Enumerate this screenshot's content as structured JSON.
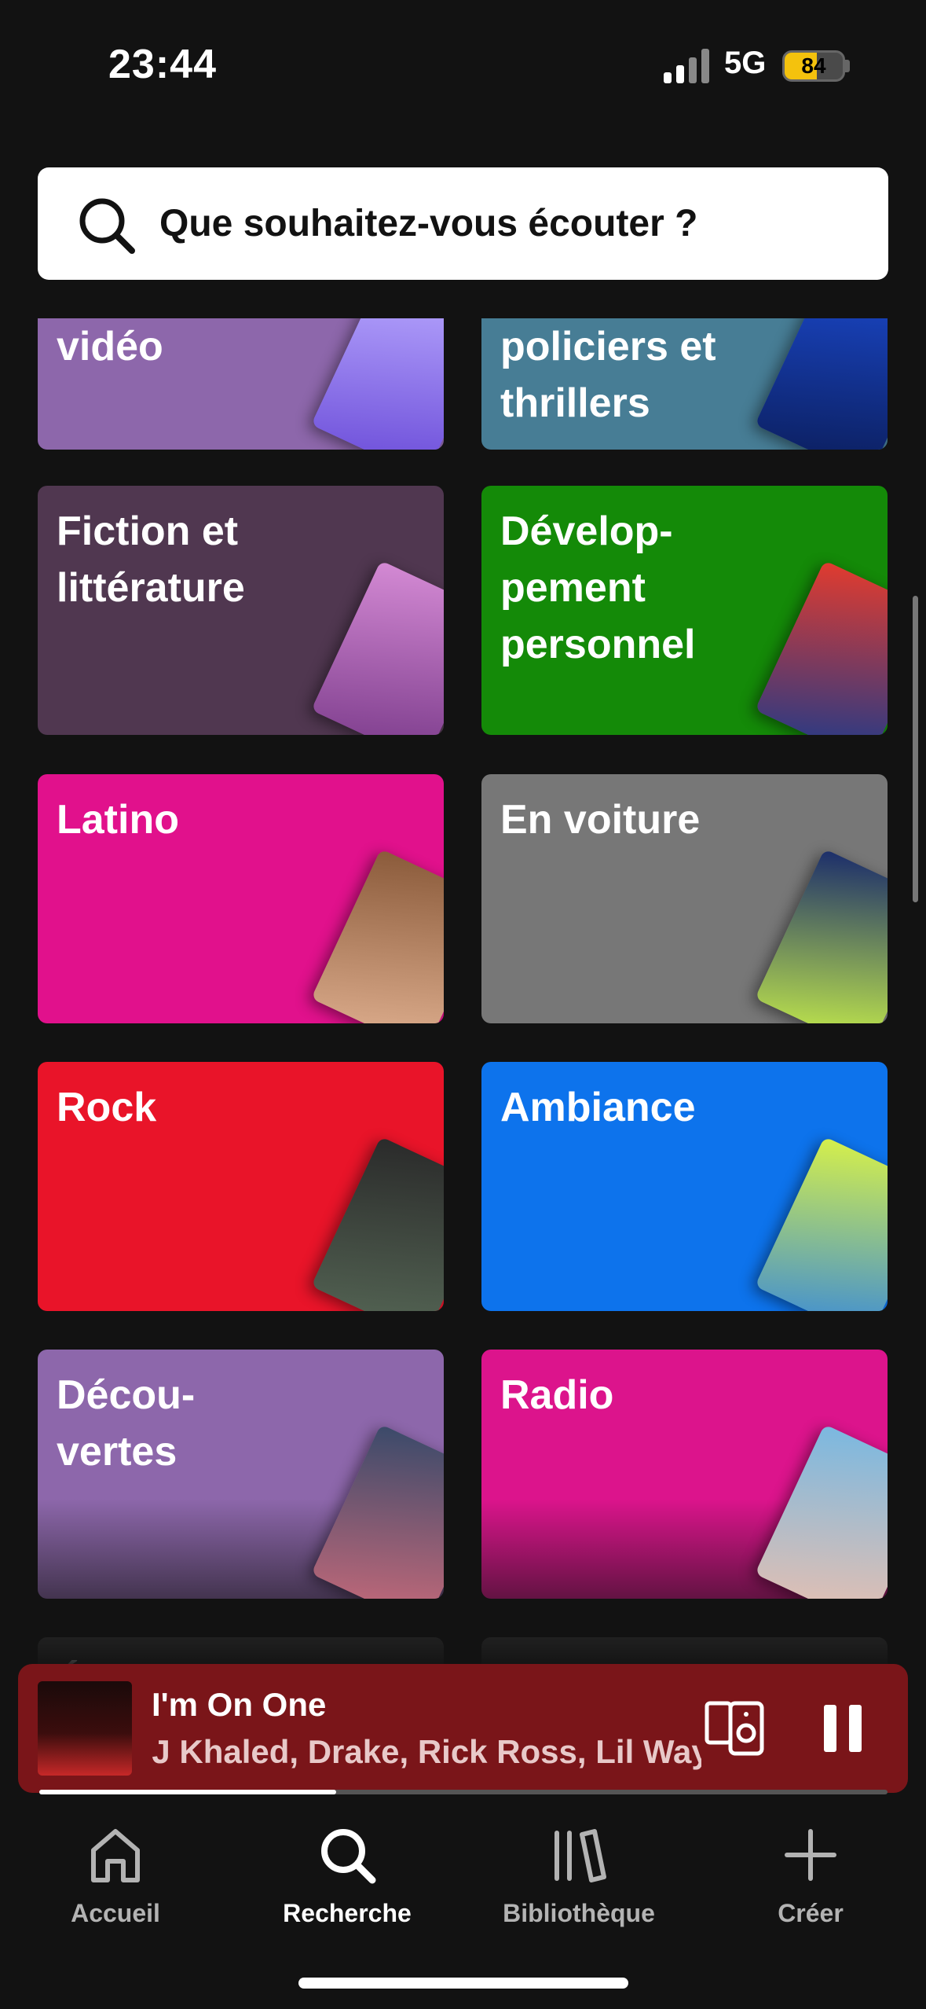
{
  "status_bar": {
    "time": "23:44",
    "network": "5G",
    "battery": "84"
  },
  "search": {
    "placeholder": "Que souhaitez-vous écouter ?"
  },
  "categories": [
    {
      "label": "vidéo",
      "color": "#8d67ab",
      "art": "La Fabuleuse"
    },
    {
      "label": "policiers et\nthrillers",
      "color": "#477d95",
      "art": "La femme de ménage"
    },
    {
      "label": "Fiction et\nlittérature",
      "color": "#503750",
      "art": "Jacaranda"
    },
    {
      "label": "Dévelop-\npement\npersonnel",
      "color": "#148a08",
      "art": "Power"
    },
    {
      "label": "Latino",
      "color": "#e1118c",
      "art": "Caliente"
    },
    {
      "label": "En voiture",
      "color": "#777777",
      "art": "Mon Daily"
    },
    {
      "label": "Rock",
      "color": "#e91429",
      "art": "Top Rock"
    },
    {
      "label": "Ambiance",
      "color": "#0d73ec",
      "art": "La vie est belle"
    },
    {
      "label": "Décou-\nvertes",
      "color": "#8d67ab",
      "art": "Découvertes de la semaine"
    },
    {
      "label": "Radio",
      "color": "#dc148c",
      "art": "Sia"
    },
    {
      "label": "Électro",
      "color": "#2d2d2d",
      "art": ""
    },
    {
      "label": "",
      "color": "#2d2d2d",
      "art": ""
    }
  ],
  "player": {
    "track": "I'm On One",
    "artists": "DJ Khaled, Drake, Rick Ross, Lil Wayne",
    "progress": 0.35,
    "color": "#7a1519"
  },
  "nav": {
    "items": [
      {
        "label": "Accueil",
        "icon": "home-icon"
      },
      {
        "label": "Recherche",
        "icon": "search-icon"
      },
      {
        "label": "Bibliothèque",
        "icon": "library-icon"
      },
      {
        "label": "Créer",
        "icon": "plus-icon"
      }
    ],
    "active": "Recherche"
  }
}
